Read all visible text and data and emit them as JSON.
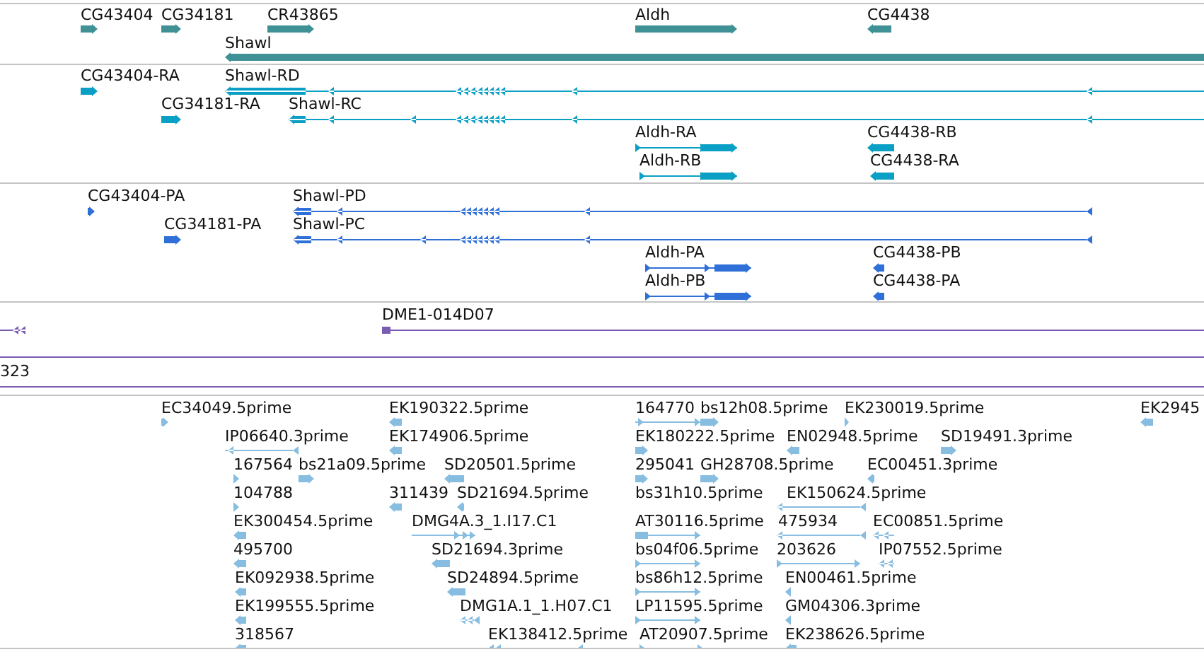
{
  "tracks": [
    {
      "kind": "gene",
      "features": [
        {
          "label": "CG43404",
          "reverse": false
        },
        {
          "label": "CG34181",
          "reverse": false
        },
        {
          "label": "CR43865",
          "reverse": false
        },
        {
          "label": "Aldh",
          "reverse": false
        },
        {
          "label": "CG4438",
          "reverse": true
        },
        {
          "label": "Shawl",
          "reverse": true
        }
      ]
    },
    {
      "kind": "transcript",
      "features": [
        {
          "label": "CG43404-RA",
          "reverse": false
        },
        {
          "label": "Shawl-RD",
          "reverse": true
        },
        {
          "label": "CG34181-RA",
          "reverse": false
        },
        {
          "label": "Shawl-RC",
          "reverse": true
        },
        {
          "label": "Aldh-RA",
          "reverse": false
        },
        {
          "label": "CG4438-RB",
          "reverse": true
        },
        {
          "label": "Aldh-RB",
          "reverse": false
        },
        {
          "label": "CG4438-RA",
          "reverse": true
        }
      ]
    },
    {
      "kind": "protein",
      "features": [
        {
          "label": "CG43404-PA",
          "reverse": false
        },
        {
          "label": "Shawl-PD",
          "reverse": true
        },
        {
          "label": "CG34181-PA",
          "reverse": false
        },
        {
          "label": "Shawl-PC",
          "reverse": true
        },
        {
          "label": "Aldh-PA",
          "reverse": false
        },
        {
          "label": "CG4438-PB",
          "reverse": true
        },
        {
          "label": "Aldh-PB",
          "reverse": false
        },
        {
          "label": "CG4438-PA",
          "reverse": true
        }
      ]
    },
    {
      "kind": "clone",
      "features": [
        {
          "reverse": true
        },
        {
          "label": "DME1-014D07",
          "reverse": false
        },
        {
          "label": "323"
        }
      ]
    },
    {
      "kind": "est",
      "features": [
        {
          "label": "EC34049.5prime",
          "reverse": false
        },
        {
          "label": "EK190322.5prime",
          "reverse": true
        },
        {
          "label": "164770",
          "reverse": false
        },
        {
          "label": "bs12h08.5prime",
          "reverse": false
        },
        {
          "label": "EK230019.5prime",
          "reverse": false
        },
        {
          "label": "EK2945",
          "reverse": true
        },
        {
          "label": "IP06640.3prime",
          "reverse": true
        },
        {
          "label": "EK174906.5prime",
          "reverse": true
        },
        {
          "label": "EK180222.5prime",
          "reverse": false
        },
        {
          "label": "EN02948.5prime",
          "reverse": true
        },
        {
          "label": "SD19491.3prime",
          "reverse": false
        },
        {
          "label": "167564",
          "reverse": false
        },
        {
          "label": "bs21a09.5prime",
          "reverse": false
        },
        {
          "label": "SD20501.5prime",
          "reverse": true
        },
        {
          "label": "295041",
          "reverse": false
        },
        {
          "label": "GH28708.5prime",
          "reverse": false
        },
        {
          "label": "EC00451.3prime",
          "reverse": true
        },
        {
          "label": "104788",
          "reverse": false
        },
        {
          "label": "311439",
          "reverse": true
        },
        {
          "label": "SD21694.5prime",
          "reverse": true
        },
        {
          "label": "bs31h10.5prime"
        },
        {
          "label": "EK150624.5prime",
          "reverse": true
        },
        {
          "label": "EK300454.5prime",
          "reverse": true
        },
        {
          "label": "DMG4A.3_1.I17.C1",
          "reverse": false
        },
        {
          "label": "AT30116.5prime",
          "reverse": false
        },
        {
          "label": "475934",
          "reverse": true
        },
        {
          "label": "EC00851.5prime",
          "reverse": true
        },
        {
          "label": "495700",
          "reverse": true
        },
        {
          "label": "SD21694.3prime",
          "reverse": true
        },
        {
          "label": "bs04f06.5prime",
          "reverse": false
        },
        {
          "label": "203626",
          "reverse": false
        },
        {
          "label": "IP07552.5prime",
          "reverse": true
        },
        {
          "label": "EK092938.5prime",
          "reverse": true
        },
        {
          "label": "SD24894.5prime",
          "reverse": true
        },
        {
          "label": "bs86h12.5prime",
          "reverse": false
        },
        {
          "label": "EN00461.5prime",
          "reverse": true
        },
        {
          "label": "EK199555.5prime",
          "reverse": true
        },
        {
          "label": "DMG1A.1_1.H07.C1",
          "reverse": true
        },
        {
          "label": "LP11595.5prime",
          "reverse": false
        },
        {
          "label": "GM04306.3prime",
          "reverse": true
        },
        {
          "label": "318567",
          "reverse": true
        },
        {
          "label": "EK138412.5prime",
          "reverse": true
        },
        {
          "label": "AT20907.5prime",
          "reverse": false
        },
        {
          "label": "EK238626.5prime",
          "reverse": true
        }
      ]
    }
  ]
}
